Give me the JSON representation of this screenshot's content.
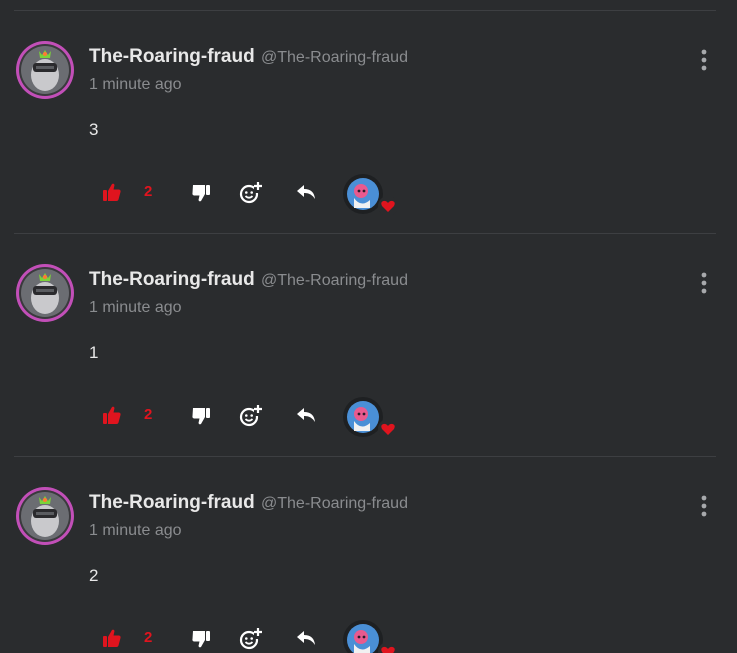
{
  "comments": [
    {
      "author": "The-Roaring-fraud",
      "handle": "@The-Roaring-fraud",
      "time": "1 minute ago",
      "text": "3",
      "likes": "2"
    },
    {
      "author": "The-Roaring-fraud",
      "handle": "@The-Roaring-fraud",
      "time": "1 minute ago",
      "text": "1",
      "likes": "2"
    },
    {
      "author": "The-Roaring-fraud",
      "handle": "@The-Roaring-fraud",
      "time": "1 minute ago",
      "text": "2",
      "likes": "2"
    }
  ],
  "icons": {
    "like": "thumbs-up-icon",
    "dislike": "thumbs-down-icon",
    "react": "add-emoji-icon",
    "reply": "reply-arrow-icon",
    "more": "kebab-menu-icon",
    "reaction_badge": "heart-icon"
  },
  "colors": {
    "background": "#2a2c2e",
    "text": "#e8e8e8",
    "muted": "#8a8c8f",
    "like_active": "#e0141e",
    "heart": "#e0141e",
    "avatar_ring": "#c24fb8"
  }
}
